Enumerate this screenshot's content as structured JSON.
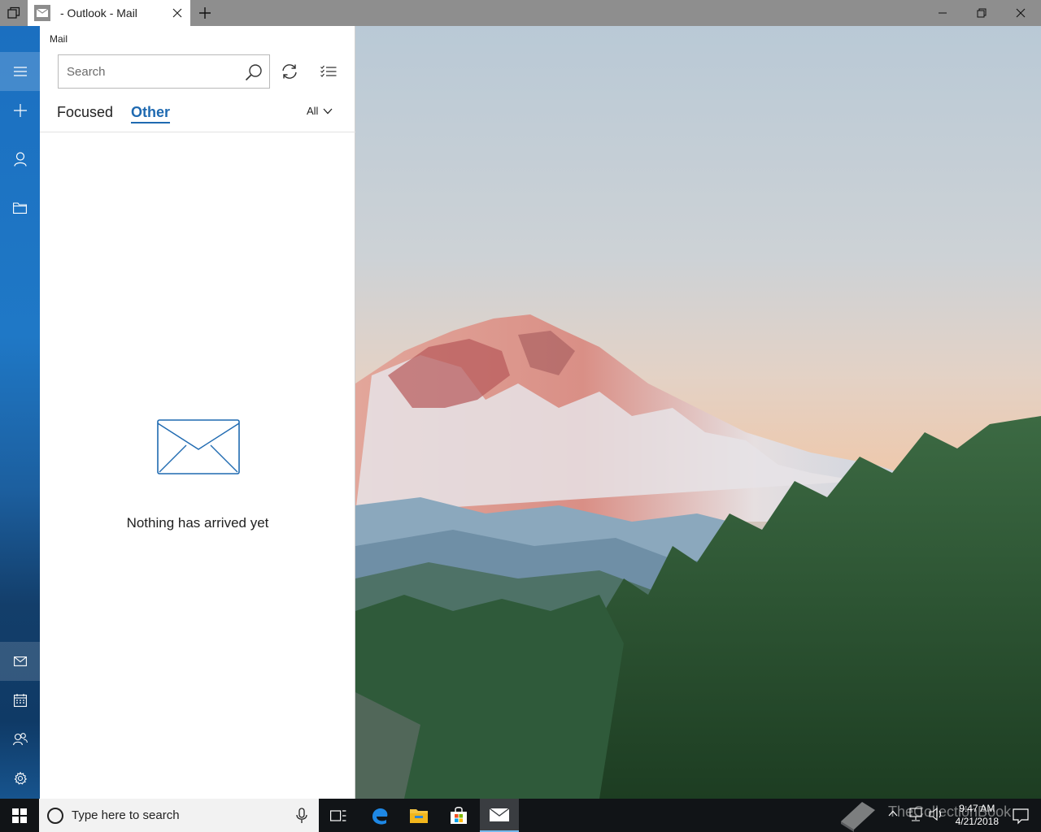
{
  "window": {
    "tab_title": "- Outlook - Mail"
  },
  "pane": {
    "app_name": "Mail",
    "search_placeholder": "Search",
    "tab_focused": "Focused",
    "tab_other": "Other",
    "filter_label": "All",
    "empty_message": "Nothing has arrived yet"
  },
  "taskbar": {
    "search_placeholder": "Type here to search",
    "time": "9:47 AM",
    "date": "4/21/2018",
    "watermark": "TheCollectionBook"
  },
  "colors": {
    "accent": "#1f6ab1",
    "rail_blue": "#1f78c6",
    "taskbar": "#111417"
  },
  "icons": {
    "rail_top": [
      "hamburger-icon",
      "plus-icon",
      "person-icon",
      "folder-icon"
    ],
    "rail_bottom": [
      "mail-icon",
      "calendar-icon",
      "people-icon",
      "gear-icon"
    ],
    "taskbar_apps": [
      "task-view-icon",
      "edge-icon",
      "file-explorer-icon",
      "store-icon",
      "mail-app-icon"
    ]
  }
}
